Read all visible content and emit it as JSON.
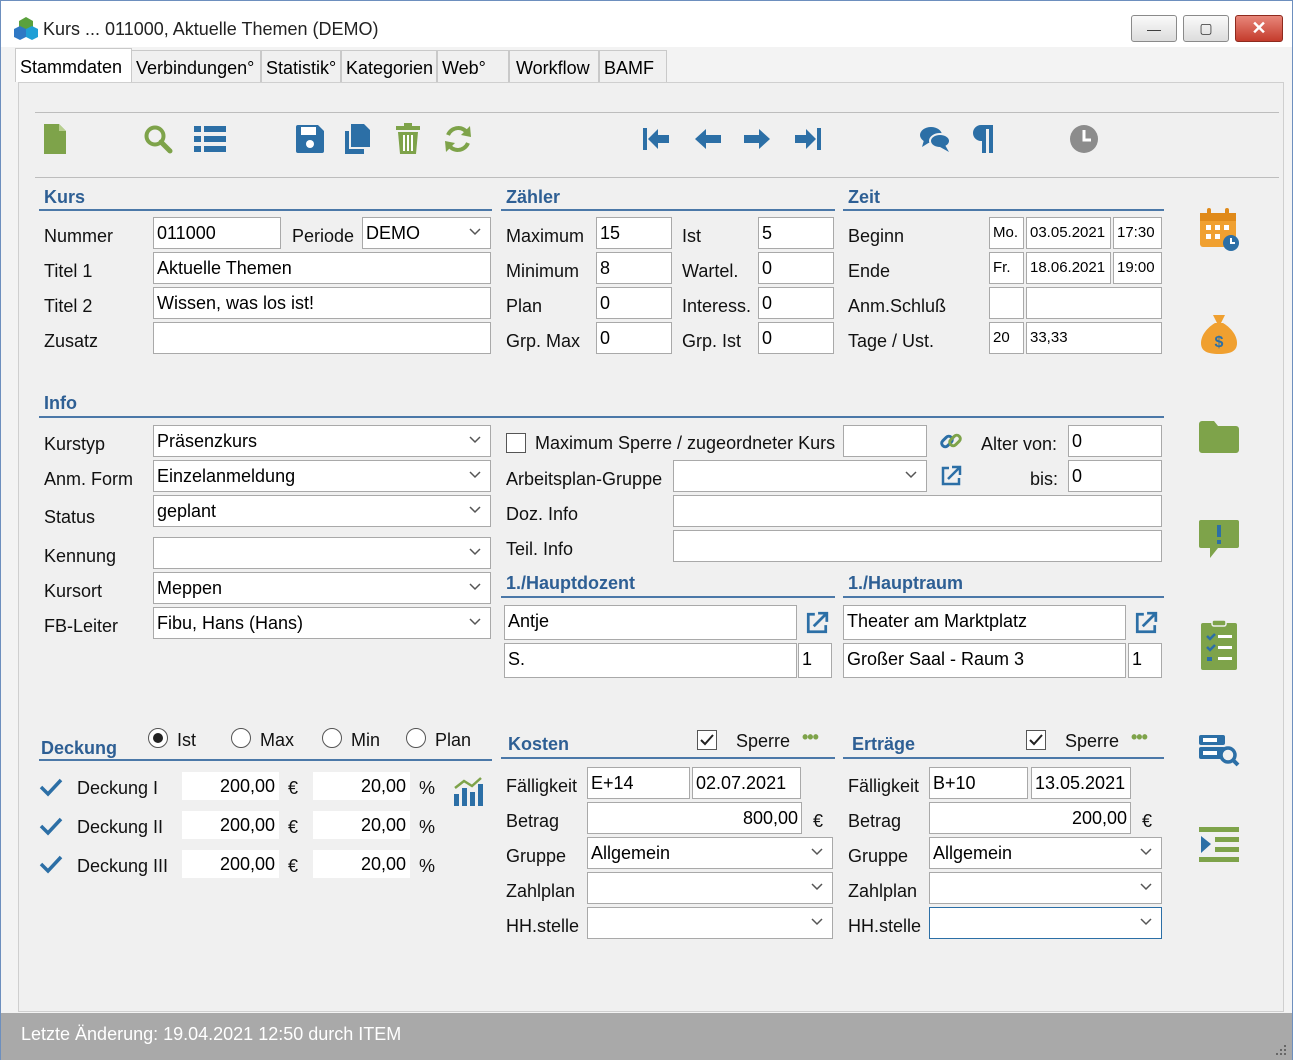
{
  "window": {
    "title": "Kurs ... 011000, Aktuelle Themen (DEMO)",
    "minimize": "—",
    "maximize": "▢",
    "close": "✕"
  },
  "tabs": [
    "Stammdaten",
    "Verbindungen°",
    "Statistik°",
    "Kategorien",
    "Web°",
    "Workflow",
    "BAMF"
  ],
  "kurs": {
    "heading": "Kurs",
    "nummer_label": "Nummer",
    "nummer": "011000",
    "periode_label": "Periode",
    "periode": "DEMO",
    "titel1_label": "Titel 1",
    "titel1": "Aktuelle Themen",
    "titel2_label": "Titel 2",
    "titel2": "Wissen, was los ist!",
    "zusatz_label": "Zusatz",
    "zusatz": ""
  },
  "zaehler": {
    "heading": "Zähler",
    "maximum_label": "Maximum",
    "maximum": "15",
    "ist_label": "Ist",
    "ist": "5",
    "minimum_label": "Minimum",
    "minimum": "8",
    "wartel_label": "Wartel.",
    "wartel": "0",
    "plan_label": "Plan",
    "plan": "0",
    "interess_label": "Interess.",
    "interess": "0",
    "grpmax_label": "Grp. Max",
    "grpmax": "0",
    "grpist_label": "Grp. Ist",
    "grpist": "0"
  },
  "zeit": {
    "heading": "Zeit",
    "beginn_label": "Beginn",
    "beginn_day": "Mo.",
    "beginn_date": "03.05.2021",
    "beginn_time": "17:30",
    "ende_label": "Ende",
    "ende_day": "Fr.",
    "ende_date": "18.06.2021",
    "ende_time": "19:00",
    "anm_label": "Anm.Schluß",
    "anm_a": "",
    "anm_b": "",
    "tage_label": "Tage / Ust.",
    "tage": "20",
    "ust": "33,33"
  },
  "info": {
    "heading": "Info",
    "kurstyp_label": "Kurstyp",
    "kurstyp": "Präsenzkurs",
    "anmform_label": "Anm. Form",
    "anmform": "Einzelanmeldung",
    "status_label": "Status",
    "status": "geplant",
    "kennung_label": "Kennung",
    "kennung": "",
    "kursort_label": "Kursort",
    "kursort": "Meppen",
    "fbleiter_label": "FB-Leiter",
    "fbleiter": "Fibu, Hans (Hans)",
    "maxsperre_label": "Maximum Sperre / zugeordneter Kurs",
    "maxsperre_value": "",
    "alter_label": "Alter von:",
    "alter_von": "0",
    "bis_label": "bis:",
    "alter_bis": "0",
    "arbeitsplan_label": "Arbeitsplan-Gruppe",
    "arbeitsplan": "",
    "dozinfo_label": "Doz. Info",
    "dozinfo": "",
    "teilinfo_label": "Teil. Info",
    "teilinfo": ""
  },
  "hauptdozent": {
    "heading": "1./Hauptdozent",
    "name1": "Antje",
    "name2": "S.",
    "count": "1"
  },
  "hauptraum": {
    "heading": "1./Hauptraum",
    "name1": "Theater am Marktplatz",
    "name2": "Großer Saal - Raum 3",
    "count": "1"
  },
  "deckung": {
    "heading": "Deckung",
    "options": [
      "Ist",
      "Max",
      "Min",
      "Plan"
    ],
    "selected": "Ist",
    "rows": [
      {
        "label": "Deckung I",
        "amount": "200,00",
        "currency": "€",
        "percent": "20,00",
        "pct": "%"
      },
      {
        "label": "Deckung II",
        "amount": "200,00",
        "currency": "€",
        "percent": "20,00",
        "pct": "%"
      },
      {
        "label": "Deckung III",
        "amount": "200,00",
        "currency": "€",
        "percent": "20,00",
        "pct": "%"
      }
    ]
  },
  "kosten": {
    "heading": "Kosten",
    "sperre_label": "Sperre",
    "sperre_checked": true,
    "more": "•••",
    "faelligkeit_label": "Fälligkeit",
    "faelligkeit_code": "E+14",
    "faelligkeit_date": "02.07.2021",
    "betrag_label": "Betrag",
    "betrag": "800,00",
    "currency": "€",
    "gruppe_label": "Gruppe",
    "gruppe": "Allgemein",
    "zahlplan_label": "Zahlplan",
    "zahlplan": "",
    "hhstelle_label": "HH.stelle",
    "hhstelle": ""
  },
  "ertraege": {
    "heading": "Erträge",
    "sperre_label": "Sperre",
    "sperre_checked": true,
    "more": "•••",
    "faelligkeit_label": "Fälligkeit",
    "faelligkeit_code": "B+10",
    "faelligkeit_date": "13.05.2021",
    "betrag_label": "Betrag",
    "betrag": "200,00",
    "currency": "€",
    "gruppe_label": "Gruppe",
    "gruppe": "Allgemein",
    "zahlplan_label": "Zahlplan",
    "zahlplan": "",
    "hhstelle_label": "HH.stelle",
    "hhstelle": ""
  },
  "statusbar": {
    "text": "Letzte Änderung: 19.04.2021 12:50 durch ITEM"
  },
  "colors": {
    "accent_blue": "#2e5f94",
    "icon_green": "#7ea34a",
    "icon_blue": "#2c6fa6",
    "icon_orange": "#f0a030",
    "close_red": "#c43b2c"
  }
}
